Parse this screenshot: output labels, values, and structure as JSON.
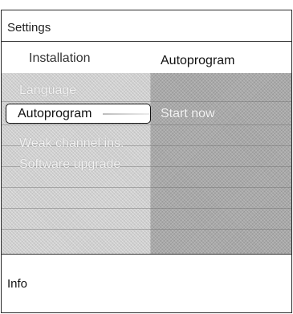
{
  "header": {
    "title": "Settings"
  },
  "breadcrumb": {
    "section": "Installation",
    "current": "Autoprogram"
  },
  "menu": {
    "items": [
      {
        "label": "Language"
      },
      {
        "label": "Autoprogram"
      },
      {
        "label": "Weak channel ins."
      },
      {
        "label": "Software upgrade"
      }
    ],
    "selected_index": 1
  },
  "submenu": {
    "items": [
      {
        "label": "Start now"
      }
    ]
  },
  "footer": {
    "info_label": "Info"
  }
}
